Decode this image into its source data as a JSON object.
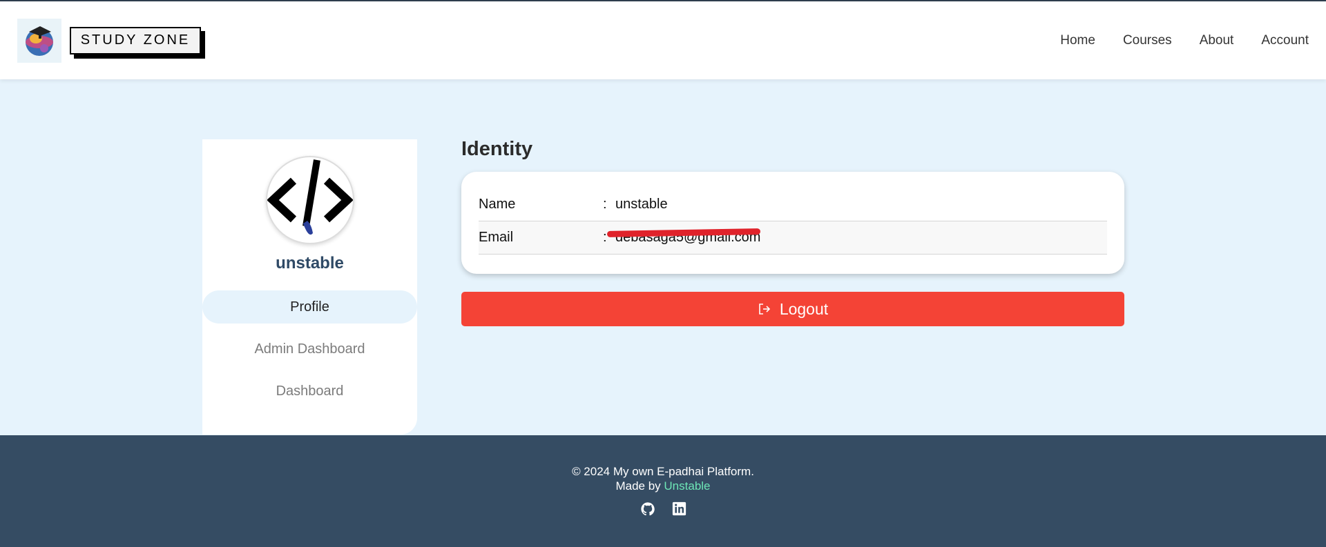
{
  "header": {
    "brand": "STUDY ZONE",
    "nav": [
      "Home",
      "Courses",
      "About",
      "Account"
    ]
  },
  "sidebar": {
    "username": "unstable",
    "items": [
      {
        "label": "Profile",
        "active": true
      },
      {
        "label": "Admin Dashboard",
        "active": false
      },
      {
        "label": "Dashboard",
        "active": false
      }
    ]
  },
  "identity": {
    "title": "Identity",
    "rows": [
      {
        "label": "Name",
        "separator": ":",
        "value": "unstable"
      },
      {
        "label": "Email",
        "separator": ":",
        "value": "debasaga5@gmail.com"
      }
    ]
  },
  "logout": {
    "label": "Logout",
    "color": "#f44336"
  },
  "footer": {
    "copyright": "© 2024 My own E-padhai Platform.",
    "made_by_prefix": "Made by ",
    "made_by_link": "Unstable",
    "icons": [
      "github-icon",
      "linkedin-icon"
    ]
  },
  "colors": {
    "page_bg": "#e6f3fc",
    "footer_bg": "#354c63",
    "accent_link": "#6ee7b7",
    "username": "#2f4a66"
  }
}
